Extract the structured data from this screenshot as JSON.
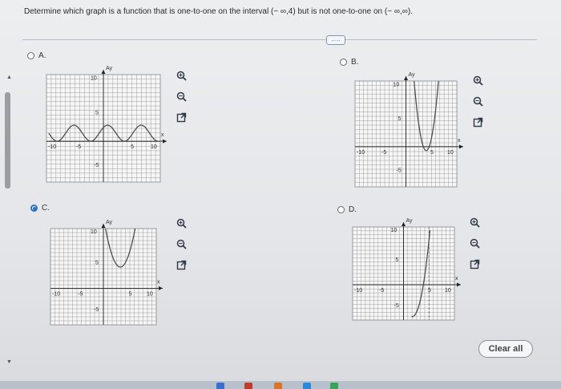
{
  "question": {
    "text": "Determine which graph is a function that is one-to-one on the interval (− ∞,4) but is not one-to-one on (− ∞,∞)."
  },
  "more_button": {
    "label": "....."
  },
  "choices": [
    {
      "id": "A",
      "label": "A.",
      "selected": false,
      "curve": "sine"
    },
    {
      "id": "B",
      "label": "B.",
      "selected": false,
      "curve": "parabola-right"
    },
    {
      "id": "C",
      "label": "C.",
      "selected": true,
      "curve": "parabola-left"
    },
    {
      "id": "D",
      "label": "D.",
      "selected": false,
      "curve": "asymptote-rise"
    }
  ],
  "axis": {
    "y_label": "Ay",
    "x_label": "x",
    "tick_pos": "10",
    "tick_neg": "-10",
    "tick_half": "5",
    "tick_neg_half": "-5"
  },
  "tools": {
    "zoom_in": "zoom-in-icon",
    "zoom_out": "zoom-out-icon",
    "expand": "expand-icon"
  },
  "clear_button": {
    "label": "Clear all"
  },
  "colors": {
    "selected": "#2a6fc2",
    "curve": "#444444",
    "grid": "#888888"
  }
}
